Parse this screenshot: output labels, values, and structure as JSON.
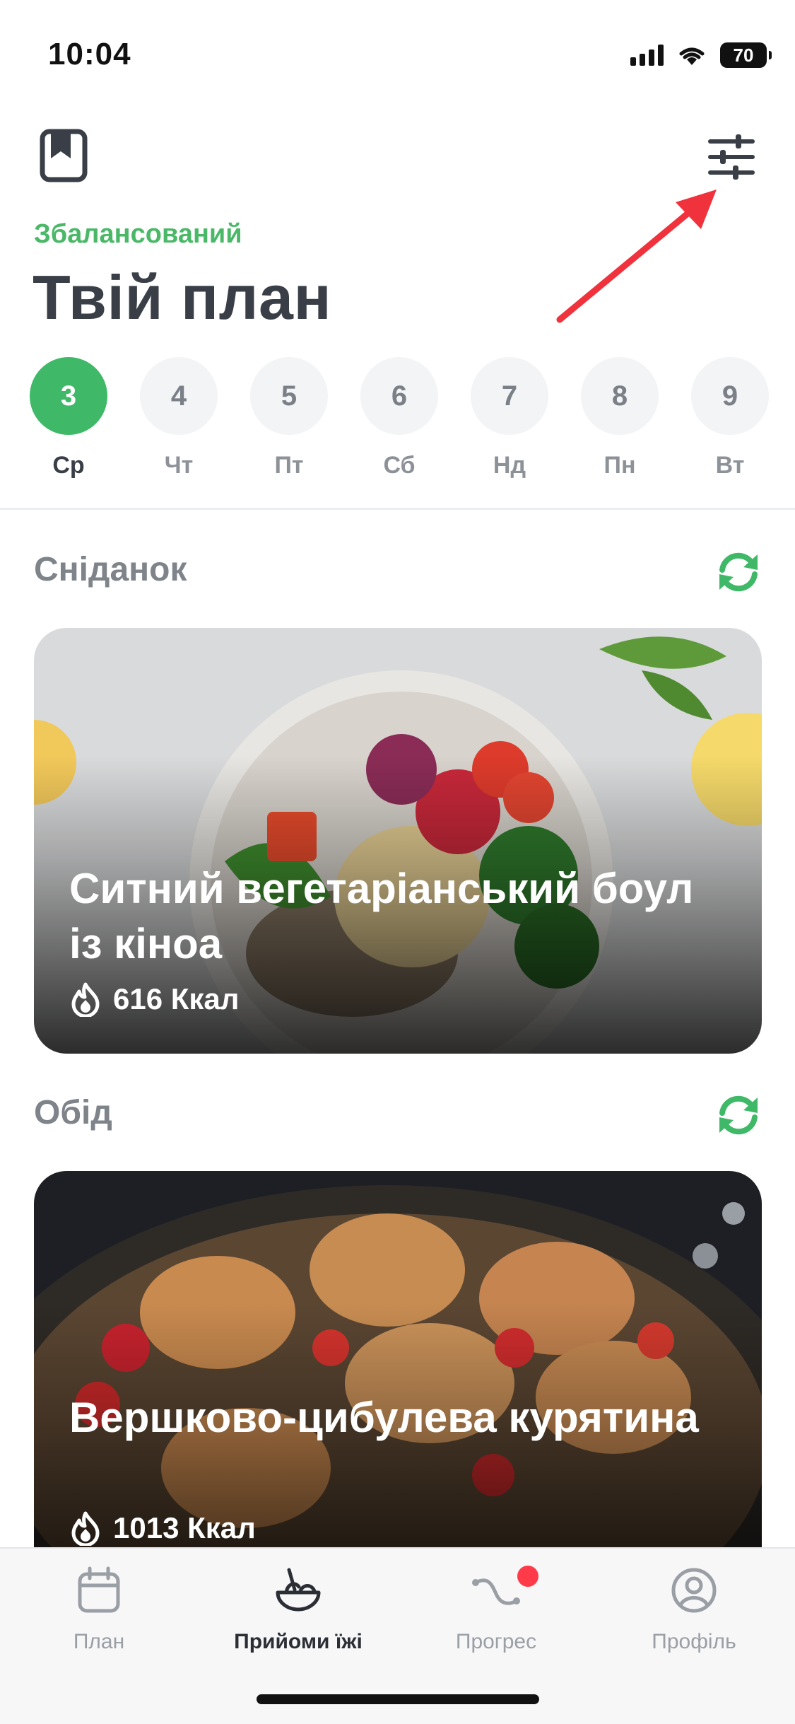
{
  "status_bar": {
    "time": "10:04",
    "battery": "70"
  },
  "header": {
    "subtitle": "Збалансований",
    "title": "Твій план"
  },
  "days": [
    {
      "num": "3",
      "label": "Ср",
      "active": true
    },
    {
      "num": "4",
      "label": "Чт"
    },
    {
      "num": "5",
      "label": "Пт"
    },
    {
      "num": "6",
      "label": "Сб"
    },
    {
      "num": "7",
      "label": "Нд"
    },
    {
      "num": "8",
      "label": "Пн"
    },
    {
      "num": "9",
      "label": "Вт"
    }
  ],
  "meals": [
    {
      "section": "Сніданок",
      "name": "Ситний вегетаріанський боул із кіноа",
      "kcal": "616 Ккал"
    },
    {
      "section": "Обід",
      "name": "Вершково-цибулева курятина",
      "kcal": "1013 Ккал"
    }
  ],
  "tabs": [
    {
      "label": "План",
      "icon": "calendar-icon"
    },
    {
      "label": "Прийоми їжі",
      "icon": "bowl-icon",
      "active": true
    },
    {
      "label": "Прогрес",
      "icon": "progress-curve-icon",
      "badge": true
    },
    {
      "label": "Профіль",
      "icon": "profile-icon"
    }
  ],
  "colors": {
    "accent": "#3fb968",
    "badge": "#ff3b4a",
    "annotation_arrow": "#f0323c"
  }
}
